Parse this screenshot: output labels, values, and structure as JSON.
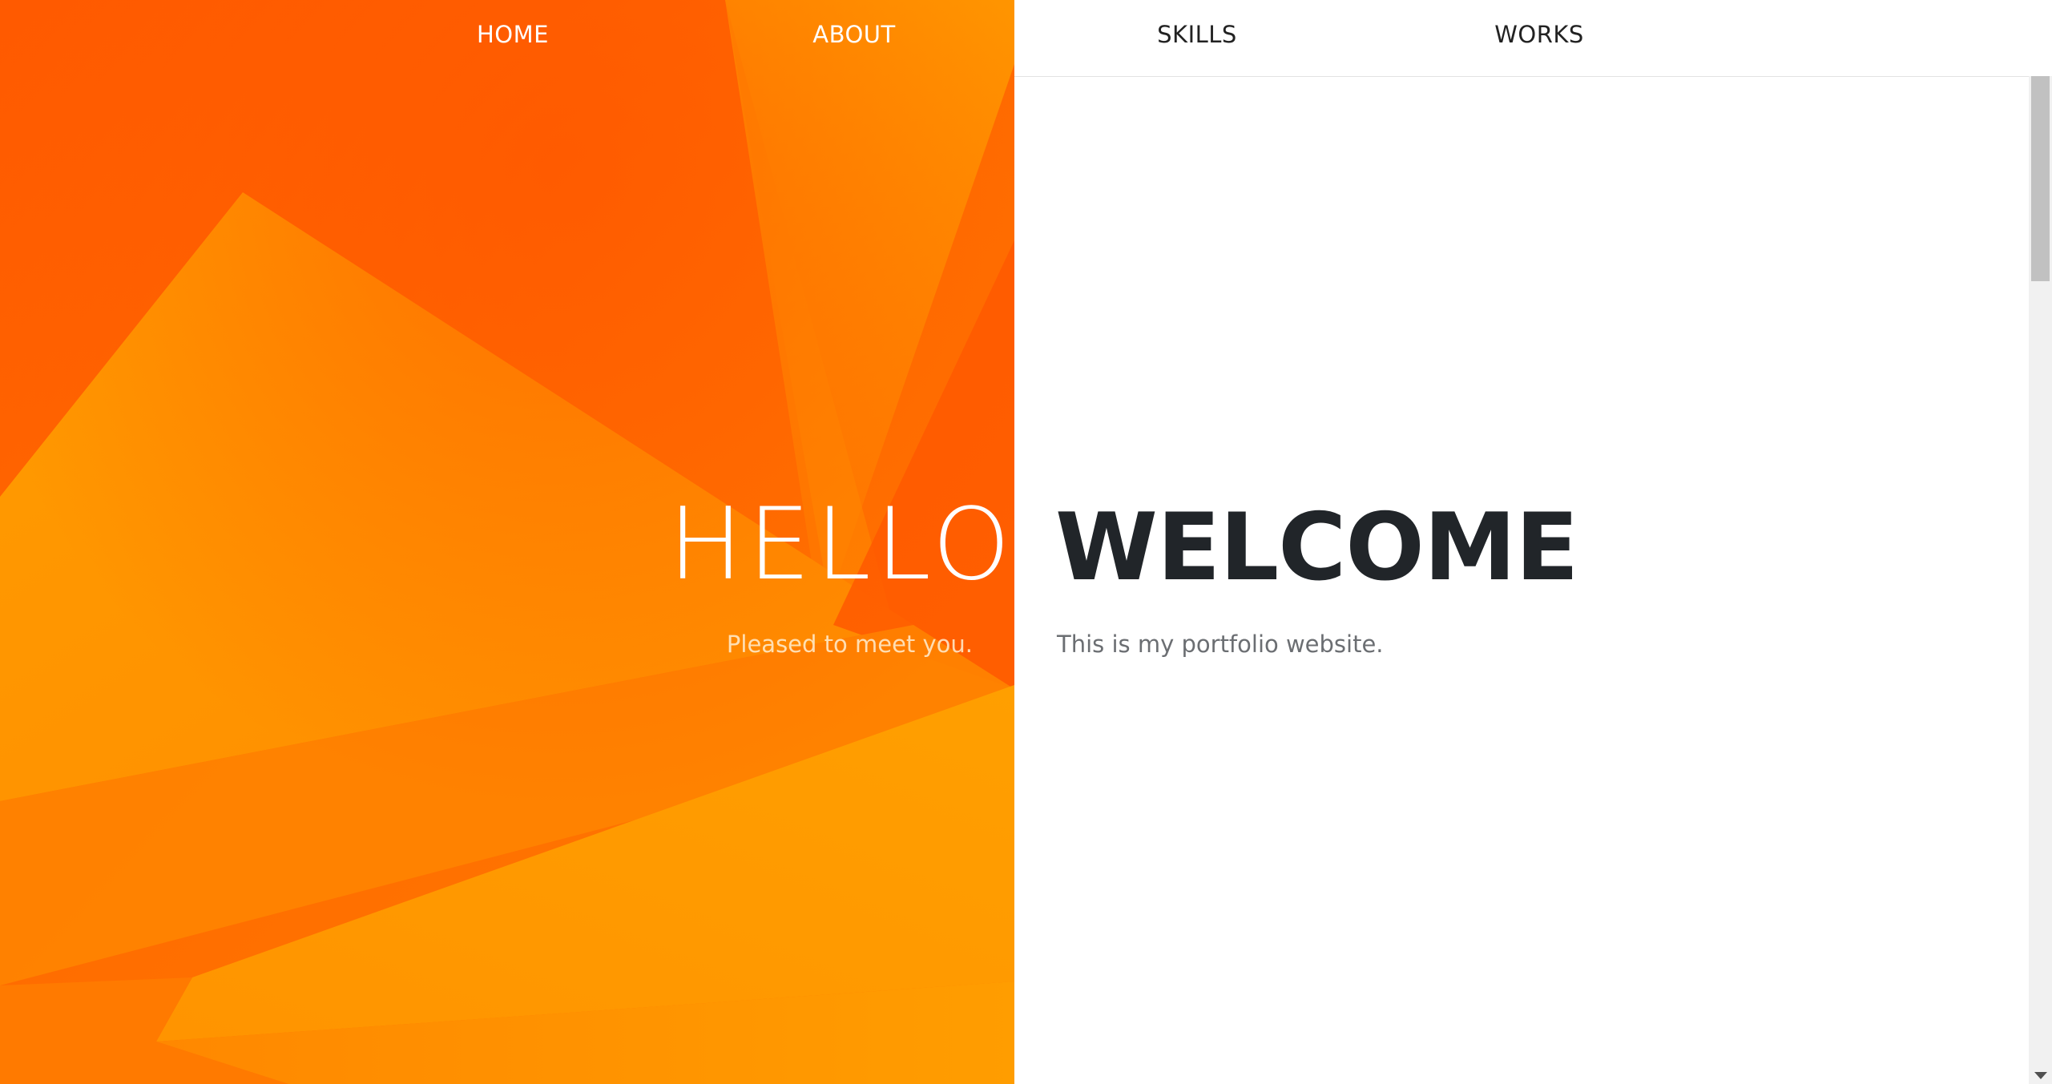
{
  "nav": {
    "items": [
      {
        "label": "HOME"
      },
      {
        "label": "ABOUT"
      },
      {
        "label": "SKILLS"
      },
      {
        "label": "WORKS"
      }
    ]
  },
  "hero": {
    "hello_title": "HELLO",
    "hello_subtitle": "Pleased to meet you.",
    "welcome_title": "WELCOME",
    "welcome_subtitle": "This is my portfolio website."
  },
  "colors": {
    "accent_orange": "#ff6a00",
    "accent_light": "#ff9a00",
    "text_dark": "#212529",
    "text_muted": "#6b6e72"
  },
  "scroll": {
    "position": 0
  }
}
